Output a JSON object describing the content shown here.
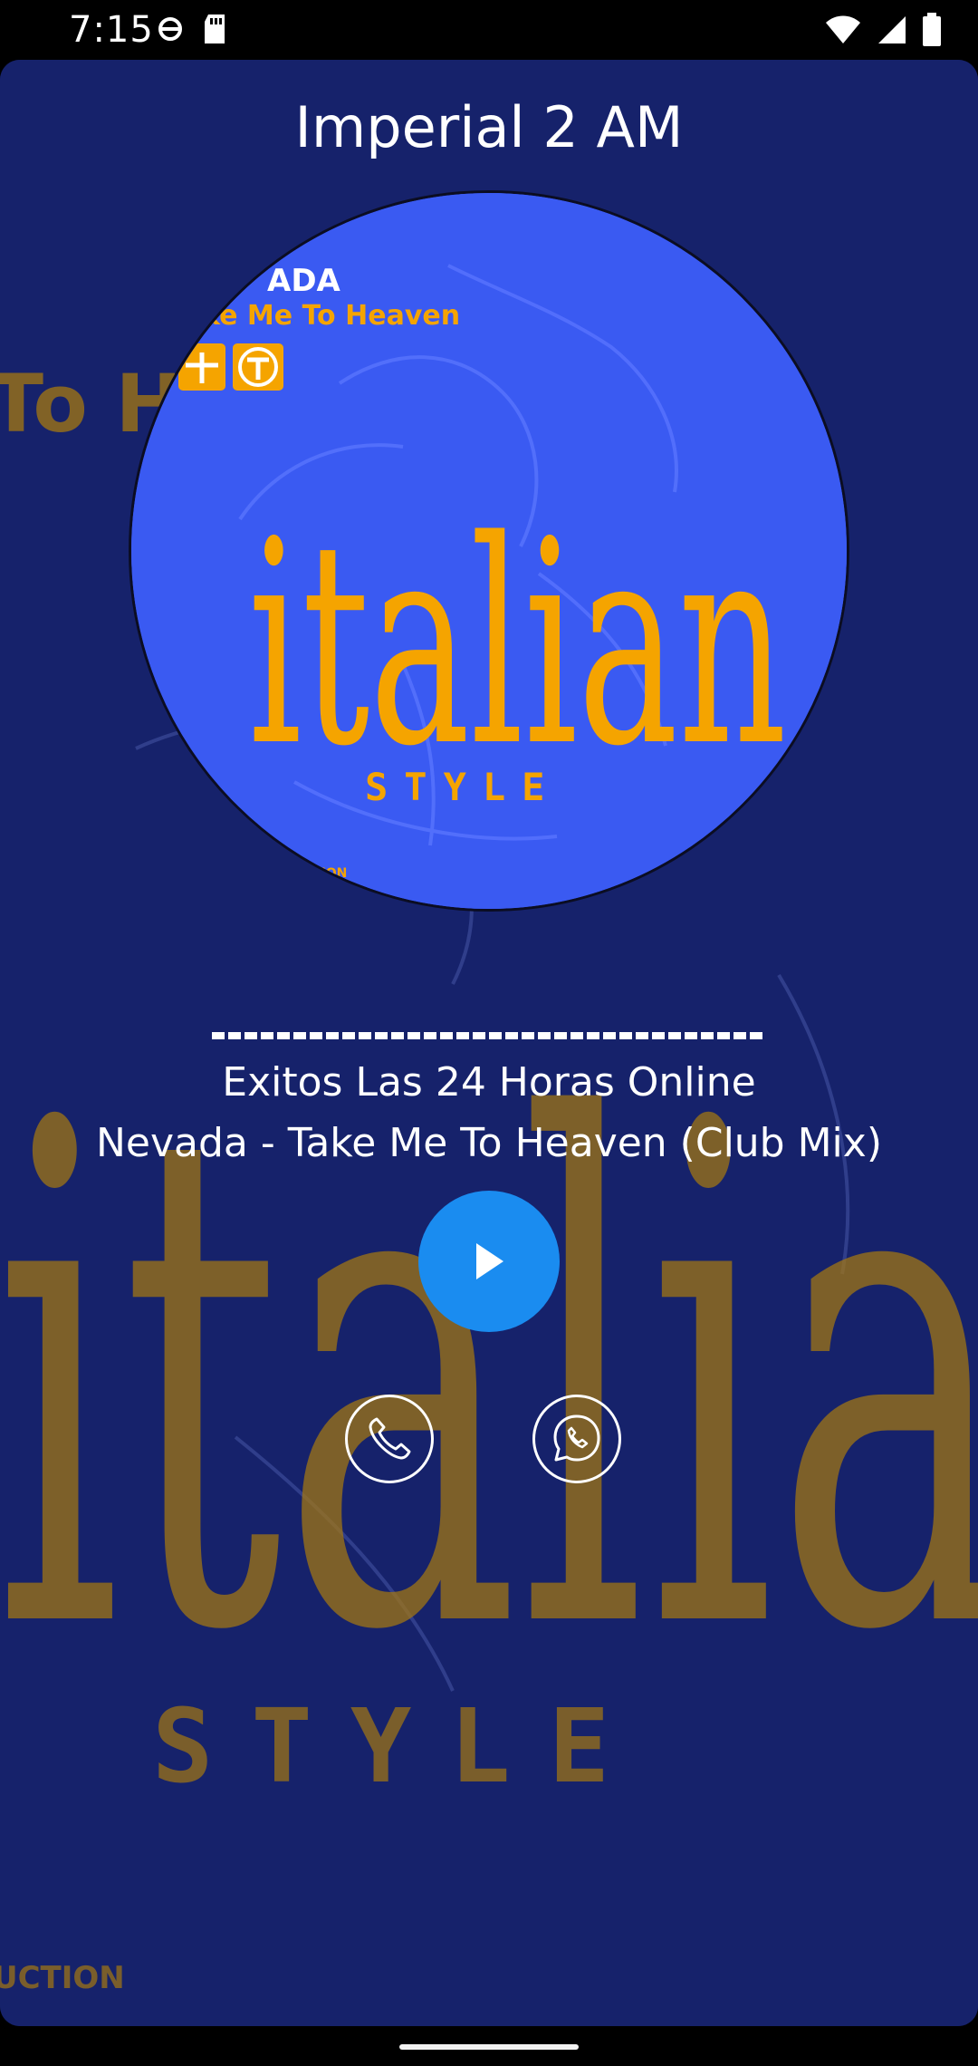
{
  "status_bar": {
    "time": "7:15",
    "left_icons": [
      "vpn-key-icon",
      "sd-card-icon"
    ],
    "right_icons": [
      "wifi-icon",
      "cell-signal-icon",
      "battery-icon"
    ]
  },
  "player": {
    "station_title": "Imperial 2 AM",
    "subtitle": "Exitos Las 24 Horas Online",
    "song": "Nevada - Take Me To Heaven (Club Mix)"
  },
  "cover_art": {
    "artist_text": "ADA",
    "title_text": "ke Me To Heaven",
    "brand_text": "italian",
    "style_text": "STYLE",
    "small_text": "TION"
  },
  "background_art": {
    "artist_text": "To H",
    "brand_text": "italian",
    "style_text": "STYLE",
    "small_text": "UCTION"
  },
  "controls": {
    "play_icon": "play-icon",
    "call_icon": "phone-icon",
    "whatsapp_icon": "whatsapp-icon"
  },
  "colors": {
    "screen_bg": "#16226b",
    "cover_bg": "#3a5af2",
    "accent": "#f5a400",
    "play_button": "#1a8cf0",
    "text": "#ffffff"
  }
}
